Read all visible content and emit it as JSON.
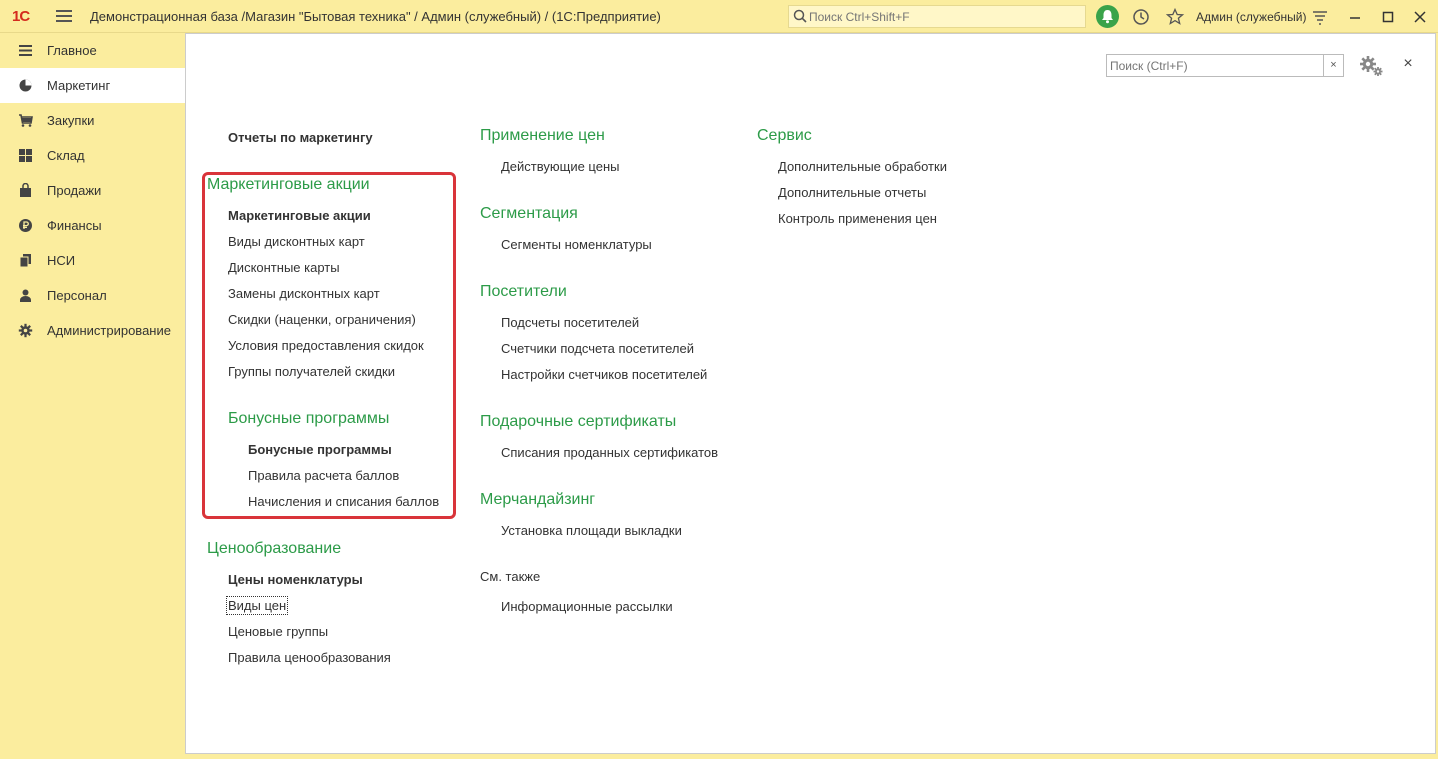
{
  "titlebar": {
    "logo": "1С",
    "window_title": "Демонстрационная база /Магазин \"Бытовая техника\" / Админ (служебный) /  (1С:Предприятие)",
    "search_placeholder": "Поиск Ctrl+Shift+F",
    "user": "Админ (служебный)"
  },
  "sidebar": {
    "items": [
      {
        "label": "Главное",
        "icon": "menu-lines-icon"
      },
      {
        "label": "Маркетинг",
        "icon": "pie-chart-icon"
      },
      {
        "label": "Закупки",
        "icon": "cart-icon"
      },
      {
        "label": "Склад",
        "icon": "warehouse-icon"
      },
      {
        "label": "Продажи",
        "icon": "bag-icon"
      },
      {
        "label": "Финансы",
        "icon": "ruble-icon"
      },
      {
        "label": "НСИ",
        "icon": "documents-icon"
      },
      {
        "label": "Персонал",
        "icon": "person-icon"
      },
      {
        "label": "Администрирование",
        "icon": "gear-icon"
      }
    ]
  },
  "form": {
    "search_placeholder": "Поиск (Ctrl+F)",
    "clear": "×",
    "close": "×"
  },
  "col1": {
    "reports": "Отчеты по маркетингу",
    "promo_header": "Маркетинговые акции",
    "promo_items": [
      "Маркетинговые акции",
      "Виды дисконтных карт",
      "Дисконтные карты",
      "Замены дисконтных карт",
      "Скидки (наценки, ограничения)",
      "Условия предоставления скидок",
      "Группы получателей скидки"
    ],
    "bonus_header": "Бонусные программы",
    "bonus_items": [
      "Бонусные программы",
      "Правила расчета баллов",
      "Начисления и списания баллов"
    ],
    "pricing_header": "Ценообразование",
    "pricing_items": [
      "Цены номенклатуры",
      "Виды цен",
      "Ценовые группы",
      "Правила ценообразования"
    ]
  },
  "col2": {
    "prices_header": "Применение цен",
    "prices_items": [
      "Действующие цены"
    ],
    "seg_header": "Сегментация",
    "seg_items": [
      "Сегменты номенклатуры"
    ],
    "visitors_header": "Посетители",
    "visitors_items": [
      "Подсчеты посетителей",
      "Счетчики подсчета посетителей",
      "Настройки счетчиков посетителей"
    ],
    "gift_header": "Подарочные сертификаты",
    "gift_items": [
      "Списания проданных сертификатов"
    ],
    "merch_header": "Мерчандайзинг",
    "merch_items": [
      "Установка площади выкладки"
    ],
    "see_also": "См. также",
    "see_also_items": [
      "Информационные рассылки"
    ]
  },
  "col3": {
    "service_header": "Сервис",
    "service_items": [
      "Дополнительные обработки",
      "Дополнительные отчеты",
      "Контроль применения цен"
    ]
  }
}
